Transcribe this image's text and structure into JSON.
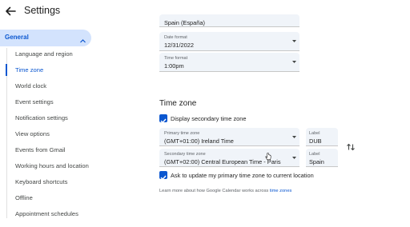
{
  "header": {
    "title": "Settings",
    "back_icon": "arrow-back-icon"
  },
  "sidebar": {
    "general_label": "General",
    "items": [
      {
        "label": "Language and region"
      },
      {
        "label": "Time zone",
        "active": true
      },
      {
        "label": "World clock"
      },
      {
        "label": "Event settings"
      },
      {
        "label": "Notification settings"
      },
      {
        "label": "View options"
      },
      {
        "label": "Events from Gmail"
      },
      {
        "label": "Working hours and location"
      },
      {
        "label": "Keyboard shortcuts"
      },
      {
        "label": "Offline"
      },
      {
        "label": "Appointment schedules"
      }
    ]
  },
  "main": {
    "country_value": "Spain (España)",
    "date_format": {
      "label": "Date format",
      "value": "12/31/2022"
    },
    "time_format": {
      "label": "Time format",
      "value": "1:00pm"
    },
    "timezone_section": {
      "title": "Time zone",
      "display_secondary_label": "Display secondary time zone",
      "display_secondary_checked": true,
      "primary": {
        "label": "Primary time zone",
        "value": "(GMT+01:00) Ireland Time"
      },
      "primary_short": {
        "label": "Label",
        "value": "DUB"
      },
      "secondary": {
        "label": "Secondary time zone",
        "value": "(GMT+02:00) Central European Time - Paris"
      },
      "secondary_short": {
        "label": "Label",
        "value": "Spain"
      },
      "ask_update_label": "Ask to update my primary time zone to current location",
      "ask_update_checked": true,
      "help_text": "Learn more about how Google Calendar works across ",
      "help_link": "time zones"
    }
  },
  "colors": {
    "accent": "#0b57d0",
    "active_nav_bg": "#d3e3fd",
    "field_bg": "#f0f4f9"
  }
}
